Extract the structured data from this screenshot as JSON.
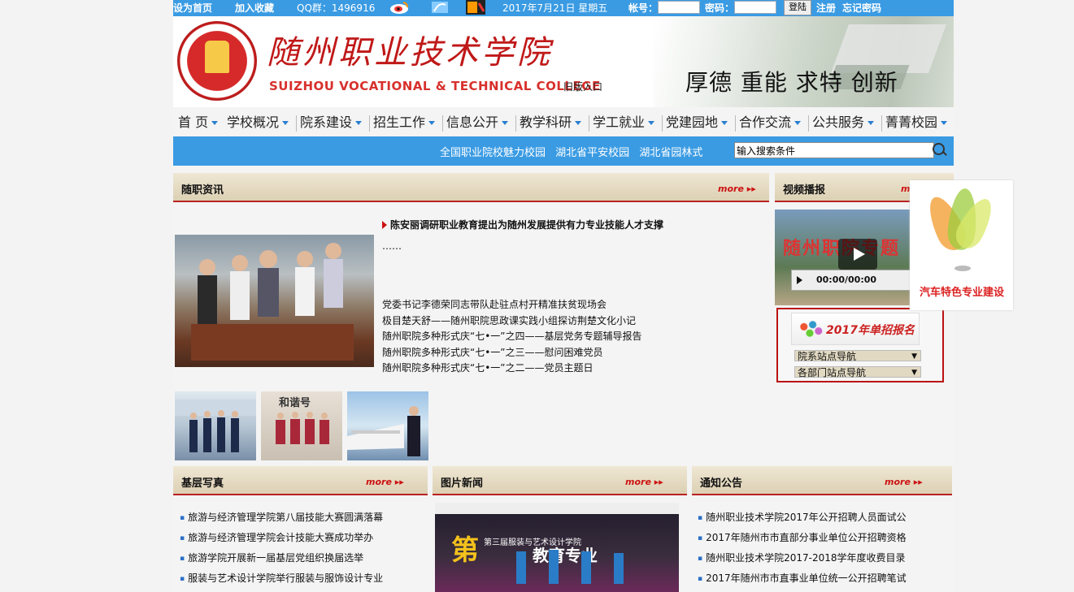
{
  "topbar": {
    "set_home": "设为首页",
    "add_fav": "加入收藏",
    "qq": "QQ群：1496916",
    "date": "2017年7月21日 星期五",
    "account_label": "帐号：",
    "password_label": "密码：",
    "login_button": "登陆",
    "register": "注册",
    "forgot": "忘记密码"
  },
  "header": {
    "college_cn": "随州职业技术学院",
    "college_en": "SUIZHOU  VOCATIONAL & TECHNICAL COLLEGE",
    "old_entry": "旧版入口",
    "slogan": "厚德 重能     求特 创新"
  },
  "nav": [
    "首 页",
    "学校概况",
    "院系建设",
    "招生工作",
    "信息公开",
    "教学科研",
    "学工就业",
    "党建园地",
    "合作交流",
    "公共服务",
    "菁菁校园"
  ],
  "searchbar": {
    "links": [
      "全国职业院校魅力校园",
      "湖北省平安校园",
      "湖北省园林式"
    ],
    "placeholder": "输入搜索条件"
  },
  "news": {
    "title": "随职资讯",
    "more": "more",
    "headline": "陈安丽调研职业教育提出为随州发展提供有力专业技能人才支撑",
    "ellipsis": "……",
    "items": [
      "党委书记李德荣同志带队赴驻点村开精准扶贫现场会",
      "极目楚天舒——随州职院思政课实践小组探访荆楚文化小记",
      "随州职院多种形式庆“七•一”之四——基层党务专题辅导报告",
      "随州职院多种形式庆“七•一”之三——慰问困难党员",
      "随州职院多种形式庆“七•一”之二——党员主题日"
    ]
  },
  "video": {
    "title": "视频播报",
    "more": "more",
    "banner": "随州职院专题",
    "time": "00:00/00:00"
  },
  "admission": {
    "banner": "2017年单招报名",
    "select1": "院系站点导航",
    "select2": "各部门站点导航"
  },
  "float_ad": {
    "caption": "汽车特色专业建设"
  },
  "grassroots": {
    "title": "基层写真",
    "more": "more",
    "items": [
      "旅游与经济管理学院第八届技能大赛圆满落幕",
      "旅游与经济管理学院会计技能大赛成功举办",
      "旅游学院开展新一届基层党组织换届选举",
      "服装与艺术设计学院举行服装与服饰设计专业"
    ]
  },
  "photo_news": {
    "title": "图片新闻",
    "more": "more",
    "banner": "第三届服装与艺术设计学院"
  },
  "notices": {
    "title": "通知公告",
    "more": "more",
    "items": [
      "随州职业技术学院2017年公开招聘人员面试公",
      "2017年随州市市直部分事业单位公开招聘资格",
      "随州职业技术学院2017-2018学年度收费目录",
      "2017年随州市市直事业单位统一公开招聘笔试"
    ]
  }
}
